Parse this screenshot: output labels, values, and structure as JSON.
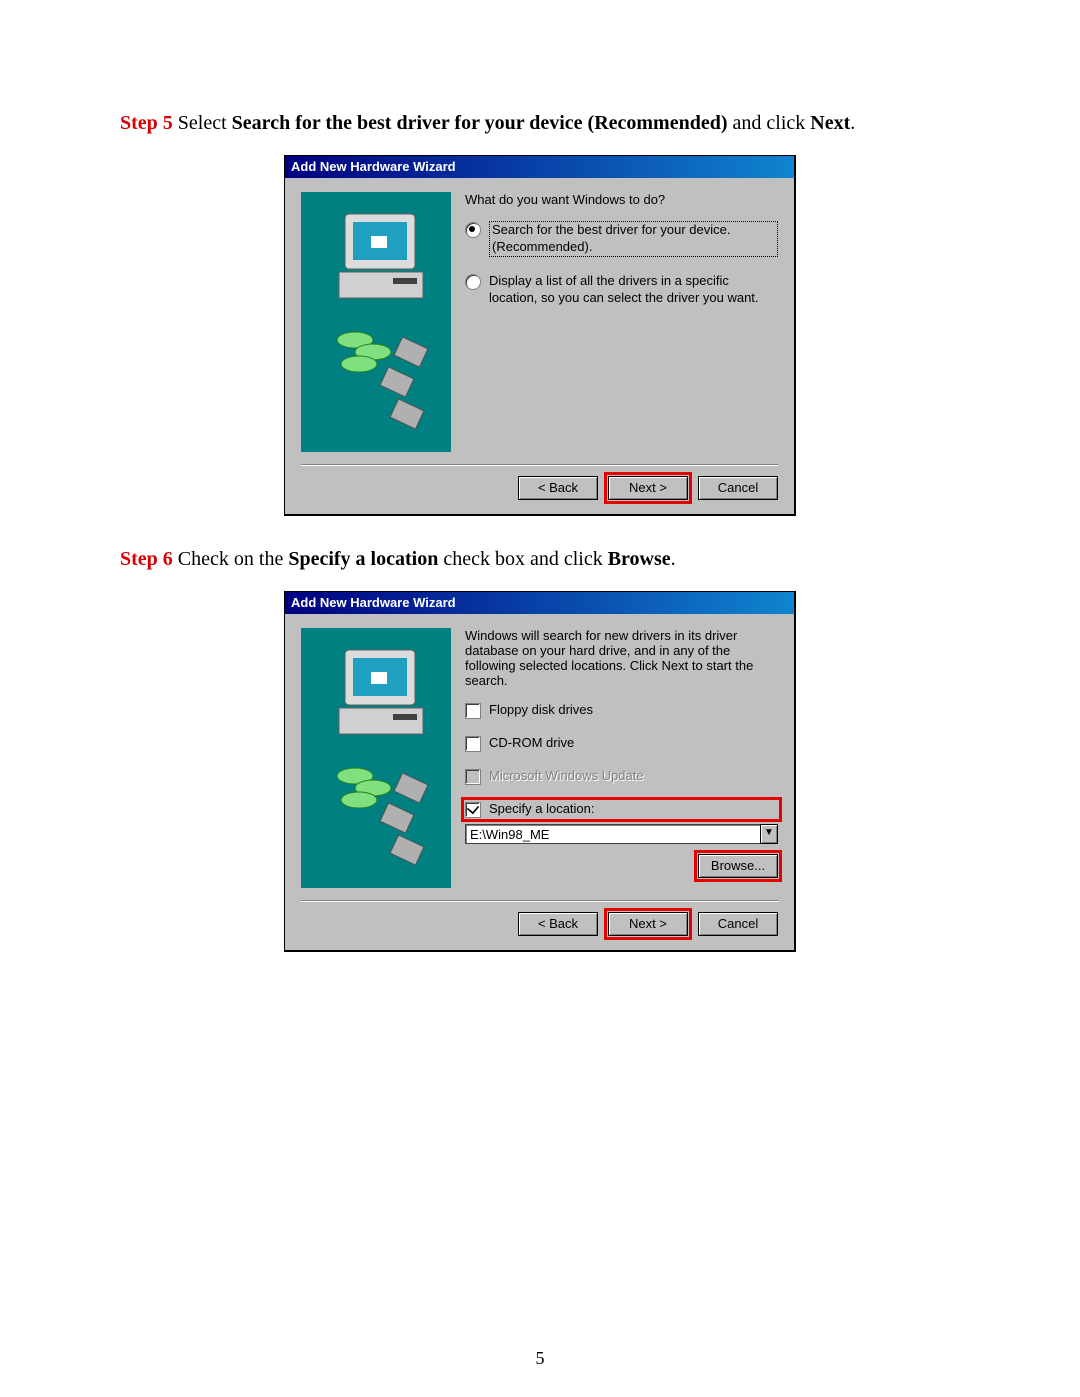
{
  "steps": {
    "s5": {
      "step_label": "Step 5",
      "text_before": " Select ",
      "bold1": "Search for the best driver for your device (Recommended)",
      "text_mid": " and click ",
      "bold2": "Next",
      "text_after": "."
    },
    "s6": {
      "step_label": "Step 6",
      "text_before": " Check on the ",
      "bold1": "Specify a location",
      "text_mid": " check box and click ",
      "bold2": "Browse",
      "text_after": "."
    }
  },
  "dialog1": {
    "title": "Add New Hardware Wizard",
    "prompt": "What do you want Windows to do?",
    "radio1": "Search for the best driver for your device. (Recommended).",
    "radio2": "Display a list of all the drivers in a specific location, so you can select the driver you want.",
    "back": "< Back",
    "next": "Next >",
    "cancel": "Cancel"
  },
  "dialog2": {
    "title": "Add New Hardware Wizard",
    "prompt": "Windows will search for new drivers in its driver database on your hard drive, and in any of the following selected locations. Click Next to start the search.",
    "chk_floppy": "Floppy disk drives",
    "chk_cdrom": "CD-ROM drive",
    "chk_wu": "Microsoft Windows Update",
    "chk_location": "Specify a location:",
    "location_value": "E:\\Win98_ME",
    "browse": "Browse...",
    "back": "< Back",
    "next": "Next >",
    "cancel": "Cancel"
  },
  "page_number": "5"
}
